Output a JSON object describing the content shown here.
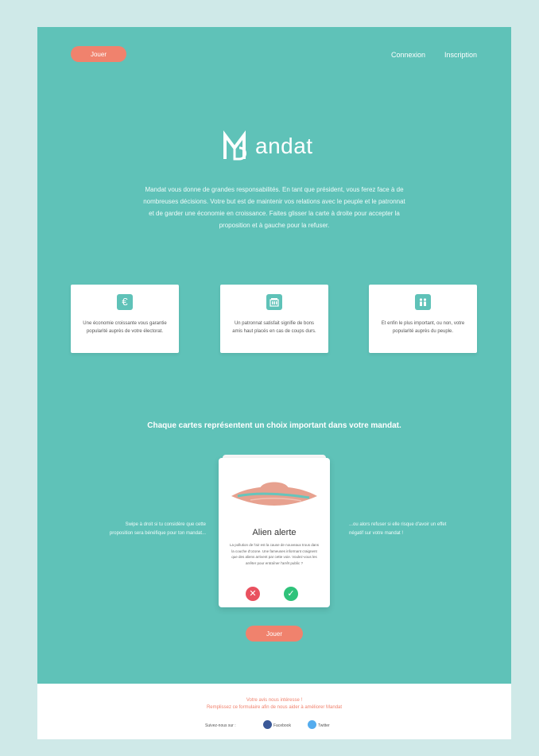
{
  "nav": {
    "play_label": "Jouer",
    "login_label": "Connexion",
    "signup_label": "Inscription"
  },
  "brand": {
    "name": "andat"
  },
  "intro": "Mandat vous donne de grandes responsabilités. En tant que président, vous ferez face à de nombreuses décisions. Votre but est de maintenir vos relations avec le peuple et le patronnat et de garder une économie en croissance. Faites glisser la carte à droite pour accepter la proposition et à gauche pour la refuser.",
  "features": [
    {
      "icon": "euro-icon",
      "text": "Une économie croissante vous garantie popularité auprès de votre électorat."
    },
    {
      "icon": "factory-icon",
      "text": "Un patronnat satisfait signifie de bons amis haut placés en cas de coups durs."
    },
    {
      "icon": "people-icon",
      "text": "Et enfin le plus important, ou non, votre popularité auprès du peuple."
    }
  ],
  "cards_heading": "Chaque cartes représentent un choix important dans votre mandat.",
  "side_left": "Swipe à droit si tu considère que cette proposition sera bénéfique pour ton mandat...",
  "side_right": "...ou alors refuser si elle risque d'avoir un effet négatif sur votre mandat !",
  "card": {
    "title": "Alien alerte",
    "text": "La pollution de l'air est la cause de nouveaux trous dans la couche d'ozone. Une fameuses informant craignent que des aliens arrivent par cette voie. Voulez-vous les arrêter pour entraîner l'arrêt public ?",
    "reject_icon": "close-icon",
    "accept_icon": "check-icon"
  },
  "main_play_label": "Jouer",
  "footer": {
    "line1": "Votre avis nous intéresse !",
    "line2": "Remplissez ce formulaire afin de nous aider à améliorer Mandat",
    "share_label": "Suivez-nous sur :",
    "facebook": "Facebook",
    "twitter": "Twitter"
  },
  "colors": {
    "primary": "#5fc2b8",
    "accent": "#f0826d",
    "reject": "#e9515f",
    "accept": "#2fc27a",
    "facebook": "#3b5998",
    "twitter": "#55acee"
  }
}
